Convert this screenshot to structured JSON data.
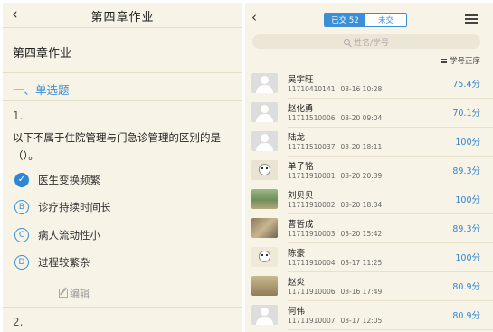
{
  "left": {
    "header": {
      "back_glyph": "‹",
      "title": "第四章作业"
    },
    "homework_title": "第四章作业",
    "section": "一、单选题",
    "question": {
      "number": "1.",
      "stem_line1": "以下不属于住院管理与门急诊管理的区别的是",
      "stem_line2": "（）。",
      "options": [
        {
          "letter": "✓",
          "text": "医生变换频繁",
          "selected": true
        },
        {
          "letter": "B",
          "text": "诊疗持续时间长",
          "selected": false
        },
        {
          "letter": "C",
          "text": "病人流动性小",
          "selected": false
        },
        {
          "letter": "D",
          "text": "过程较繁杂",
          "selected": false
        }
      ],
      "edit_label": "编辑"
    },
    "next_question_number": "2."
  },
  "right": {
    "header": {
      "back_glyph": "‹",
      "tab_submitted": "已交 52",
      "tab_unsubmitted": "未交",
      "menu_icon": "hamburger-icon"
    },
    "search": {
      "placeholder": "姓名/学号"
    },
    "sort_label": "学号正序",
    "students": [
      {
        "name": "吴宇旺",
        "id": "11710410141",
        "date": "03-16 10:28",
        "score": "75.4分",
        "avatar": "default"
      },
      {
        "name": "赵化勇",
        "id": "11711510006",
        "date": "03-20 09:04",
        "score": "70.1分",
        "avatar": "default"
      },
      {
        "name": "陆龙",
        "id": "11711510037",
        "date": "03-20 18:11",
        "score": "100分",
        "avatar": "default"
      },
      {
        "name": "单子铭",
        "id": "11711910001",
        "date": "03-20 20:39",
        "score": "89.3分",
        "avatar": "cartoon-face"
      },
      {
        "name": "刘贝贝",
        "id": "11711910002",
        "date": "03-20 18:34",
        "score": "100分",
        "avatar": "landscape-photo"
      },
      {
        "name": "曹哲成",
        "id": "11711910003",
        "date": "03-20 15:42",
        "score": "89.3分",
        "avatar": "group-photo"
      },
      {
        "name": "陈豪",
        "id": "11711910004",
        "date": "03-17 11:25",
        "score": "100分",
        "avatar": "cartoon-hat"
      },
      {
        "name": "赵炎",
        "id": "11711910006",
        "date": "03-16 17:49",
        "score": "80.9分",
        "avatar": "cartoon-hat-2"
      },
      {
        "name": "何伟",
        "id": "11711910007",
        "date": "03-17 12:05",
        "score": "80.9分",
        "avatar": "default"
      }
    ]
  },
  "colors": {
    "accent": "#2f86d4",
    "background": "#f7f3e6",
    "divider": "#e4ddc7"
  }
}
